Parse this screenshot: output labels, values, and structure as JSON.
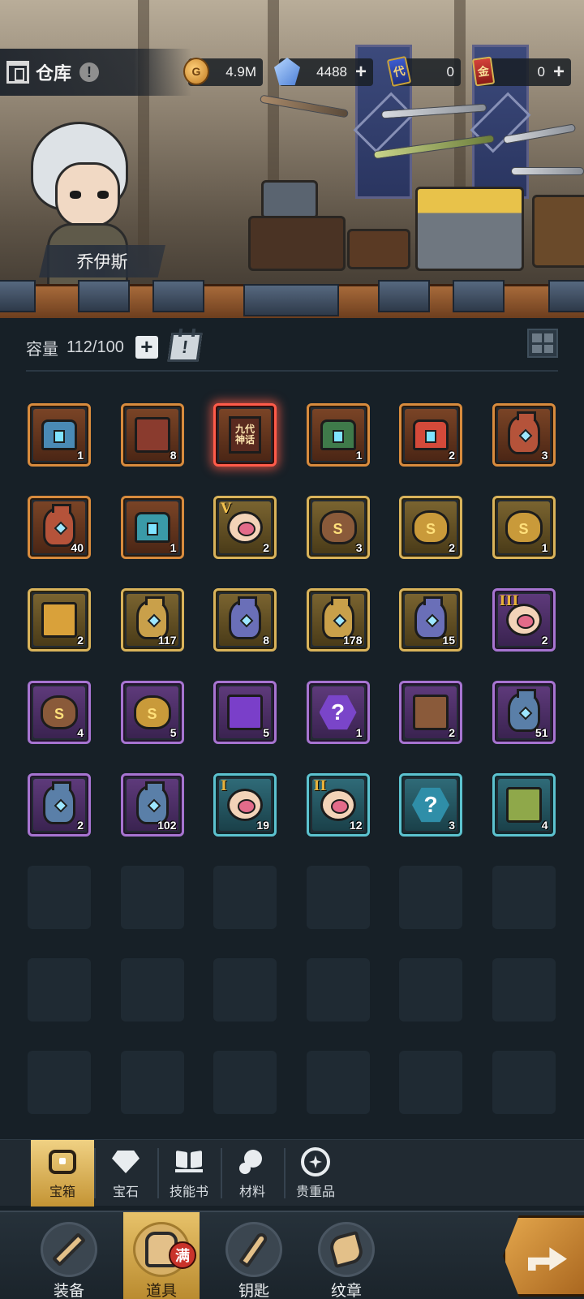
{
  "header": {
    "title": "仓库",
    "info_icon": "info-icon",
    "hero_name": "乔伊斯"
  },
  "resources": [
    {
      "name": "coin",
      "icon": "coin-icon",
      "value": "4.9M",
      "has_add": false
    },
    {
      "name": "gem",
      "icon": "gem-icon",
      "value": "4488",
      "has_add": true
    },
    {
      "name": "ticket-blue",
      "icon": "ticket-icon",
      "icon_text": "代",
      "value": "0",
      "has_add": false
    },
    {
      "name": "ticket-red",
      "icon": "ticket-icon",
      "icon_text": "金",
      "value": "0",
      "has_add": true
    }
  ],
  "capacity": {
    "label": "容量",
    "value": "112/100"
  },
  "inventory": {
    "items": [
      {
        "kind": "chest",
        "rarity": "orange",
        "count": "1",
        "color": "#4a8ab5"
      },
      {
        "kind": "crate",
        "rarity": "orange",
        "count": "8",
        "color": "#8a3b2e"
      },
      {
        "kind": "scroll",
        "rarity": "selected",
        "count": "",
        "label": "九代神话"
      },
      {
        "kind": "chest",
        "rarity": "orange",
        "count": "1",
        "color": "#3f7a4a"
      },
      {
        "kind": "chest",
        "rarity": "orange",
        "count": "2",
        "color": "#d44a3a"
      },
      {
        "kind": "jar",
        "rarity": "orange",
        "count": "3",
        "color": "#b5533a"
      },
      {
        "kind": "jar",
        "rarity": "orange",
        "count": "40",
        "color": "#b5533a"
      },
      {
        "kind": "chest",
        "rarity": "orange",
        "count": "1",
        "color": "#3a9aa8"
      },
      {
        "kind": "paw",
        "rarity": "gold",
        "count": "2",
        "tag": "V",
        "tag_color": "#f2c14e"
      },
      {
        "kind": "bag",
        "rarity": "gold",
        "count": "3",
        "color": "#8a5a3a"
      },
      {
        "kind": "bag",
        "rarity": "gold",
        "count": "2",
        "color": "#c99a3a"
      },
      {
        "kind": "bag",
        "rarity": "gold",
        "count": "1",
        "color": "#c99a3a"
      },
      {
        "kind": "crate",
        "rarity": "gold",
        "count": "2",
        "color": "#d9a13a"
      },
      {
        "kind": "jar",
        "rarity": "gold",
        "count": "117",
        "color": "#c9a04a"
      },
      {
        "kind": "jar",
        "rarity": "gold",
        "count": "8",
        "color": "#6a6fb8"
      },
      {
        "kind": "jar",
        "rarity": "gold",
        "count": "178",
        "color": "#c9a04a"
      },
      {
        "kind": "jar",
        "rarity": "gold",
        "count": "15",
        "color": "#6a6fb8"
      },
      {
        "kind": "paw",
        "rarity": "purple",
        "count": "2",
        "tag": "III",
        "tag_color": "#e8b13a"
      },
      {
        "kind": "bag",
        "rarity": "purple",
        "count": "4",
        "color": "#8a5a3a"
      },
      {
        "kind": "bag",
        "rarity": "purple",
        "count": "5",
        "color": "#c99a3a"
      },
      {
        "kind": "crate",
        "rarity": "purple",
        "count": "5",
        "color": "#7a3fc9"
      },
      {
        "kind": "question",
        "rarity": "purple",
        "count": "1",
        "color": "#7a45c9"
      },
      {
        "kind": "crate",
        "rarity": "purple",
        "count": "2",
        "color": "#8a5a3a"
      },
      {
        "kind": "jar",
        "rarity": "purple",
        "count": "51",
        "color": "#5a7fa8"
      },
      {
        "kind": "jar",
        "rarity": "purple",
        "count": "2",
        "color": "#5a7fa8"
      },
      {
        "kind": "jar",
        "rarity": "purple",
        "count": "102",
        "color": "#5a7fa8"
      },
      {
        "kind": "paw",
        "rarity": "teal",
        "count": "19",
        "tag": "I",
        "tag_color": "#e8b13a"
      },
      {
        "kind": "paw",
        "rarity": "teal",
        "count": "12",
        "tag": "II",
        "tag_color": "#e8b13a"
      },
      {
        "kind": "question",
        "rarity": "teal",
        "count": "3",
        "color": "#2f8ea8"
      },
      {
        "kind": "crate",
        "rarity": "teal",
        "count": "4",
        "color": "#8fa84a"
      }
    ],
    "empty_slots": 18
  },
  "categories": [
    {
      "label": "宝箱",
      "icon": "chest-icon",
      "active": true
    },
    {
      "label": "宝石",
      "icon": "gem-icon",
      "active": false
    },
    {
      "label": "技能书",
      "icon": "book-icon",
      "active": false
    },
    {
      "label": "材料",
      "icon": "materials-icon",
      "active": false
    },
    {
      "label": "贵重品",
      "icon": "valuables-icon",
      "active": false
    }
  ],
  "nav": [
    {
      "label": "装备",
      "icon": "sword-icon",
      "active": false
    },
    {
      "label": "道具",
      "icon": "backpack-icon",
      "active": true,
      "badge": "满"
    },
    {
      "label": "钥匙",
      "icon": "key-icon",
      "active": false
    },
    {
      "label": "纹章",
      "icon": "emblem-icon",
      "active": false
    }
  ],
  "share": {
    "icon": "share-arrow-icon"
  }
}
